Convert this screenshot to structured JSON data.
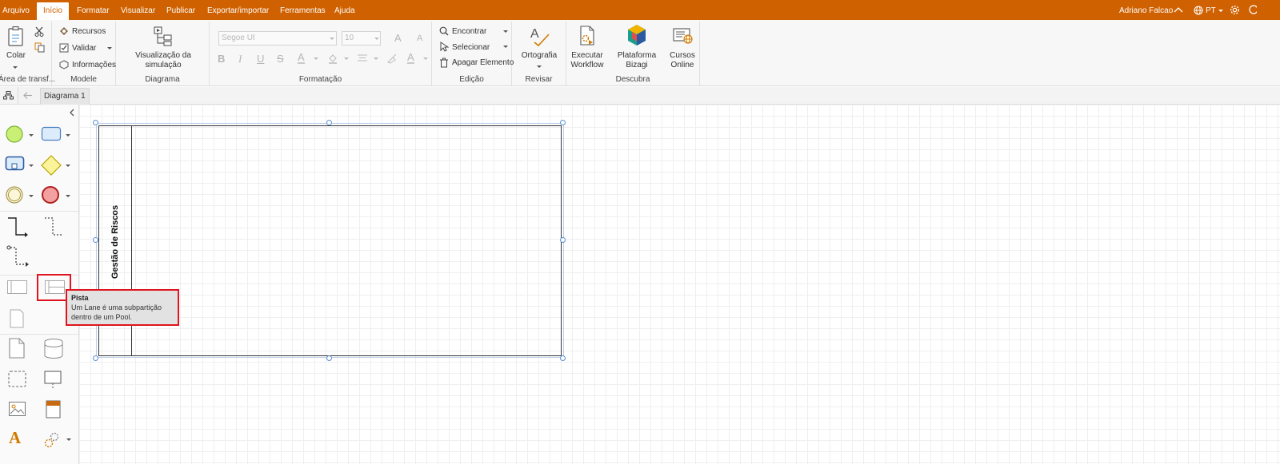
{
  "menu": {
    "items": [
      "Arquivo",
      "Início",
      "Formatar",
      "Visualizar",
      "Publicar",
      "Exportar/importar",
      "Ferramentas",
      "Ajuda"
    ],
    "active_index": 1,
    "user": "Adriano Falcao",
    "language": "PT"
  },
  "ribbon": {
    "clipboard": {
      "paste_label": "Colar",
      "group_label": "Área de transf..."
    },
    "model": {
      "resources": "Recursos",
      "validate": "Validar",
      "info": "Informações",
      "group_label": "Modele"
    },
    "diagram": {
      "sim_view": "Visualização da simulação",
      "group_label": "Diagrama"
    },
    "format": {
      "font_name": "Segoe UI",
      "font_size": "10",
      "group_label": "Formatação"
    },
    "edit": {
      "find": "Encontrar",
      "select": "Selecionar",
      "delete": "Apagar Elemento",
      "group_label": "Edição"
    },
    "review": {
      "spelling": "Ortografia",
      "group_label": "Revisar"
    },
    "discover": {
      "run_workflow_1": "Executar",
      "run_workflow_2": "Workflow",
      "platform": "Plataforma Bizagi",
      "courses_1": "Cursos",
      "courses_2": "Online",
      "group_label": "Descubra"
    }
  },
  "tabs": {
    "active": "Diagrama 1"
  },
  "pool": {
    "title": "Gestão de Riscos"
  },
  "tooltip": {
    "title": "Pista",
    "line1": "Um Lane é uma subpartição",
    "line2": "dentro de um Pool."
  },
  "colors": {
    "brand": "#cf6100",
    "selection": "#5a8fd1",
    "highlight": "#e0141e"
  }
}
